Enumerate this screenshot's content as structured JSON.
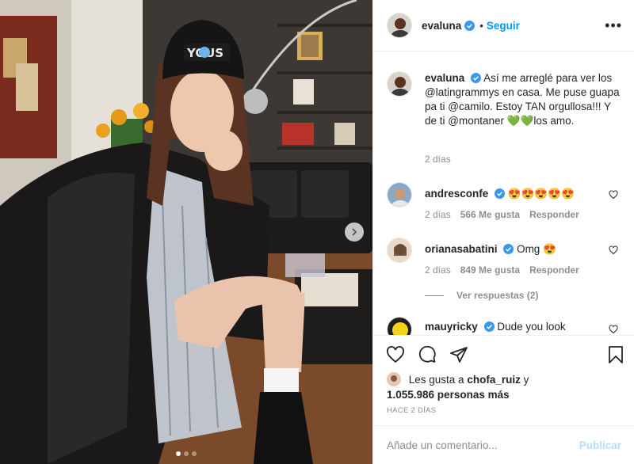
{
  "post": {
    "author": "evaluna",
    "follow_label": "Seguir",
    "separator": "•",
    "more_label": "•••",
    "caption": "Así me arreglé para ver los @latingrammys en casa. Me puse guapa pa ti @camilo. Estoy TAN orgullosa!!! Y de ti @montaner 💚💚los amo.",
    "caption_time": "2 días",
    "image_pages": 3,
    "image_current": 1
  },
  "comments": [
    {
      "user": "andresconfe",
      "text": "😍😍😍😍😍",
      "time": "2 días",
      "likes": "566 Me gusta",
      "reply": "Responder"
    },
    {
      "user": "orianasabatini",
      "text": "Omg 😍",
      "time": "2 días",
      "likes": "849 Me gusta",
      "reply": "Responder",
      "view_replies": "Ver respuestas (2)"
    },
    {
      "user": "mauyricky",
      "text": "Dude you look"
    }
  ],
  "likes": {
    "prefix": "Les gusta a",
    "first_user": "chofa_ruiz",
    "conj": "y",
    "count": "1.055.986 personas más"
  },
  "timestamp": "HACE 2 DÍAS",
  "add_comment": {
    "placeholder": "Añade un comentario...",
    "publish": "Publicar"
  },
  "colors": {
    "accent": "#0095f6",
    "verified": "#3897f0",
    "publish_disabled": "#b2dffc"
  }
}
